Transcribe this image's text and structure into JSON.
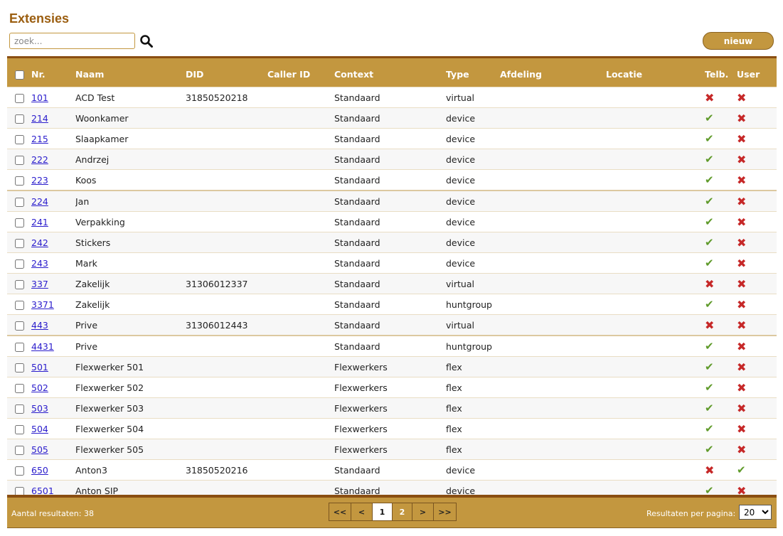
{
  "page": {
    "title": "Extensies"
  },
  "search": {
    "placeholder": "zoek..."
  },
  "toolbar": {
    "new_label": "nieuw"
  },
  "table": {
    "headers": {
      "nr": "Nr.",
      "naam": "Naam",
      "did": "DID",
      "callerid": "Caller ID",
      "context": "Context",
      "type": "Type",
      "afdeling": "Afdeling",
      "locatie": "Locatie",
      "telb": "Telb.",
      "user": "User"
    },
    "rows": [
      {
        "nr": "101",
        "naam": "ACD Test",
        "did": "31850520218",
        "callerid": "",
        "context": "Standaard",
        "type": "virtual",
        "afdeling": "",
        "locatie": "",
        "telb": false,
        "user": false
      },
      {
        "nr": "214",
        "naam": "Woonkamer",
        "did": "",
        "callerid": "",
        "context": "Standaard",
        "type": "device",
        "afdeling": "",
        "locatie": "",
        "telb": true,
        "user": false
      },
      {
        "nr": "215",
        "naam": "Slaapkamer",
        "did": "",
        "callerid": "",
        "context": "Standaard",
        "type": "device",
        "afdeling": "",
        "locatie": "",
        "telb": true,
        "user": false
      },
      {
        "nr": "222",
        "naam": "Andrzej",
        "did": "",
        "callerid": "",
        "context": "Standaard",
        "type": "device",
        "afdeling": "",
        "locatie": "",
        "telb": true,
        "user": false
      },
      {
        "nr": "223",
        "naam": "Koos",
        "did": "",
        "callerid": "",
        "context": "Standaard",
        "type": "device",
        "afdeling": "",
        "locatie": "",
        "telb": true,
        "user": false
      },
      {
        "nr": "224",
        "naam": "Jan",
        "did": "",
        "callerid": "",
        "context": "Standaard",
        "type": "device",
        "afdeling": "",
        "locatie": "",
        "telb": true,
        "user": false
      },
      {
        "nr": "241",
        "naam": "Verpakking",
        "did": "",
        "callerid": "",
        "context": "Standaard",
        "type": "device",
        "afdeling": "",
        "locatie": "",
        "telb": true,
        "user": false
      },
      {
        "nr": "242",
        "naam": "Stickers",
        "did": "",
        "callerid": "",
        "context": "Standaard",
        "type": "device",
        "afdeling": "",
        "locatie": "",
        "telb": true,
        "user": false
      },
      {
        "nr": "243",
        "naam": "Mark",
        "did": "",
        "callerid": "",
        "context": "Standaard",
        "type": "device",
        "afdeling": "",
        "locatie": "",
        "telb": true,
        "user": false
      },
      {
        "nr": "337",
        "naam": "Zakelijk",
        "did": "31306012337",
        "callerid": "",
        "context": "Standaard",
        "type": "virtual",
        "afdeling": "",
        "locatie": "",
        "telb": false,
        "user": false
      },
      {
        "nr": "3371",
        "naam": "Zakelijk",
        "did": "",
        "callerid": "",
        "context": "Standaard",
        "type": "huntgroup",
        "afdeling": "",
        "locatie": "",
        "telb": true,
        "user": false
      },
      {
        "nr": "443",
        "naam": "Prive",
        "did": "31306012443",
        "callerid": "",
        "context": "Standaard",
        "type": "virtual",
        "afdeling": "",
        "locatie": "",
        "telb": false,
        "user": false
      },
      {
        "nr": "4431",
        "naam": "Prive",
        "did": "",
        "callerid": "",
        "context": "Standaard",
        "type": "huntgroup",
        "afdeling": "",
        "locatie": "",
        "telb": true,
        "user": false
      },
      {
        "nr": "501",
        "naam": "Flexwerker 501",
        "did": "",
        "callerid": "",
        "context": "Flexwerkers",
        "type": "flex",
        "afdeling": "",
        "locatie": "",
        "telb": true,
        "user": false
      },
      {
        "nr": "502",
        "naam": "Flexwerker 502",
        "did": "",
        "callerid": "",
        "context": "Flexwerkers",
        "type": "flex",
        "afdeling": "",
        "locatie": "",
        "telb": true,
        "user": false
      },
      {
        "nr": "503",
        "naam": "Flexwerker 503",
        "did": "",
        "callerid": "",
        "context": "Flexwerkers",
        "type": "flex",
        "afdeling": "",
        "locatie": "",
        "telb": true,
        "user": false
      },
      {
        "nr": "504",
        "naam": "Flexwerker 504",
        "did": "",
        "callerid": "",
        "context": "Flexwerkers",
        "type": "flex",
        "afdeling": "",
        "locatie": "",
        "telb": true,
        "user": false
      },
      {
        "nr": "505",
        "naam": "Flexwerker 505",
        "did": "",
        "callerid": "",
        "context": "Flexwerkers",
        "type": "flex",
        "afdeling": "",
        "locatie": "",
        "telb": true,
        "user": false
      },
      {
        "nr": "650",
        "naam": "Anton3",
        "did": "31850520216",
        "callerid": "",
        "context": "Standaard",
        "type": "device",
        "afdeling": "",
        "locatie": "",
        "telb": false,
        "user": true
      },
      {
        "nr": "6501",
        "naam": "Anton SIP",
        "did": "",
        "callerid": "",
        "context": "Standaard",
        "type": "device",
        "afdeling": "",
        "locatie": "",
        "telb": true,
        "user": false
      }
    ]
  },
  "footer": {
    "result_count": "Aantal resultaten: 38",
    "per_page_label": "Resultaten per pagina:",
    "per_page_value": "20"
  },
  "pagination": {
    "first": "<<",
    "prev": "<",
    "next": ">",
    "last": ">>",
    "pages": [
      "1",
      "2"
    ],
    "current": "1"
  },
  "icons": {
    "check": "check-icon",
    "cross": "cross-icon"
  },
  "colors": {
    "brand": "#c3973f",
    "title": "#9b5e10",
    "check": "#5f9a2a",
    "cross": "#c62828",
    "link": "#2a1ccc"
  }
}
